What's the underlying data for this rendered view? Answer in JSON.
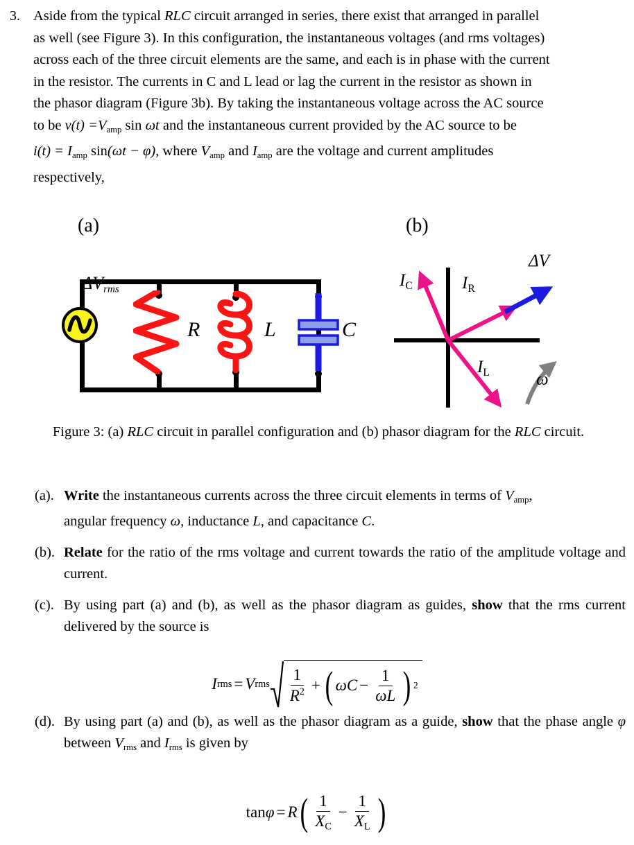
{
  "problem": {
    "number": "3.",
    "lines": [
      "Aside from the typical RLC circuit arranged in series, there exist that arranged in parallel",
      "as well (see Figure 3).  In this configuration, the instantaneous voltages (and rms voltages)",
      "across each of the three circuit elements are the same, and each is in phase with the current",
      "in the resistor.  The currents in C and L lead or lag the current in the resistor as shown in",
      "the phasor diagram (Figure 3b).  By taking the instantaneous voltage across the AC source",
      "to be v(t) = Vamp sin ωt and the instantaneous current provided by the AC source to be",
      "i(t) = Iamp sin(ωt − φ) , where Vamp and Iamp are the voltage and current amplitudes",
      "respectively,"
    ],
    "line1": {
      "w1": "Aside",
      "w2": "from",
      "w3": "the",
      "w4": "typical",
      "rlc": "RLC",
      "w5": "circuit",
      "w6": "arranged",
      "w7": "in",
      "w8": "series,",
      "w9": "there",
      "w10": "exist",
      "w11": "that",
      "w12": "arranged",
      "w13": "in",
      "w14": "parallel"
    },
    "line2": {
      "w1": "as",
      "w2": "well",
      "w3": "(see",
      "w4": "Figure",
      "w5": "3).",
      "w6": "In",
      "w7": "this",
      "w8": "configuration,",
      "w9": "the",
      "w10": "instantaneous",
      "w11": "voltages",
      "w12": "(and",
      "w13": "rms",
      "w14": "voltages)"
    },
    "line3": {
      "w1": "across",
      "w2": "each",
      "w3": "of",
      "w4": "the",
      "w5": "three",
      "w6": "circuit",
      "w7": "elements",
      "w8": "are",
      "w9": "the",
      "w10": "same,",
      "w11": "and",
      "w12": "each",
      "w13": "is",
      "w14": "in",
      "w15": "phase",
      "w16": "with",
      "w17": "the",
      "w18": "current"
    },
    "line4": {
      "w1": "in",
      "w2": "the",
      "w3": "resistor.",
      "w4": "The",
      "w5": "currents",
      "w6": "in",
      "w7": "C",
      "w8": "and",
      "w9": "L",
      "w10": "lead",
      "w11": "or",
      "w12": "lag",
      "w13": "the",
      "w14": "current",
      "w15": "in",
      "w16": "the",
      "w17": "resistor",
      "w18": "as",
      "w19": "shown",
      "w20": "in"
    },
    "line5": {
      "w1": "the",
      "w2": "phasor",
      "w3": "diagram",
      "w4": "(Figure",
      "w5": "3b).",
      "w6": "By",
      "w7": "taking",
      "w8": "the",
      "w9": "instantaneous",
      "w10": "voltage",
      "w11": "across",
      "w12": "the",
      "w13": "AC",
      "w14": "source"
    },
    "line6": {
      "w1": "to",
      "w2": "be",
      "eq_v": "v(t) =",
      "V": "V",
      "amp": "amp",
      "w3": "sin",
      "omega_t": "ωt",
      "w4": "and",
      "w5": "the",
      "w6": "instantaneous",
      "w7": "current",
      "w8": "provided",
      "w9": "by",
      "w10": "the",
      "w11": "AC",
      "w12": "source",
      "w13": "to",
      "w14": "be"
    },
    "line7": {
      "eq_i": "i(t) = I",
      "amp": "amp",
      "sin": "sin",
      "arg": "(ωt − φ)",
      "comma": ",",
      "w1": "where",
      "V": "V",
      "amp2": "amp",
      "w2": "and",
      "I": "I",
      "amp3": "amp",
      "w3": "are",
      "w4": "the",
      "w5": "voltage",
      "w6": "and",
      "w7": "current",
      "w8": "amplitudes"
    },
    "line8": "respectively,"
  },
  "figure": {
    "panel_a_label": "(a)",
    "panel_b_label": "(b)",
    "circuit": {
      "source_label_delta_v": "ΔV",
      "source_label_sub": "rms",
      "resistor_label": "R",
      "inductor_label": "L",
      "capacitor_label": "C",
      "colors": {
        "source_fill": "#f7f31e",
        "resistor": "#fa1414",
        "inductor": "#fa1414",
        "capacitor": "#1a1ae0",
        "capacitor_plate_inner": "#8f9ff0",
        "wire": "#000000"
      }
    },
    "phasor": {
      "ic_label": "I",
      "ic_sub": "C",
      "ir_label": "I",
      "ir_sub": "R",
      "il_label": "I",
      "il_sub": "L",
      "dv_label": "ΔV",
      "omega_label": "ω",
      "colors": {
        "current_arrow": "#ee1289",
        "voltage_arrow": "#1a1ae0",
        "omega_arrow": "#808080",
        "axis": "#000000"
      }
    },
    "caption": {
      "t1": "Figure 3: (a) ",
      "rlc1": "RLC",
      "t2": " circuit in parallel configuration and (b) phasor diagram for the ",
      "rlc2": "RLC",
      "t3": " circuit."
    }
  },
  "parts": {
    "a": {
      "marker": "(a).",
      "bold": "Write",
      "text1": " the instantaneous currents across the three circuit elements in terms of ",
      "V": "V",
      "Vsub": "amp",
      "text2": ",",
      "line2_a": "angular frequency ",
      "omega": "ω",
      "line2_b": ", inductance ",
      "L": "L",
      "line2_c": ", and capacitance ",
      "C": "C",
      "line2_d": "."
    },
    "b": {
      "marker": "(b).",
      "bold": "Relate",
      "text": " for the ratio of the rms voltage and current towards the ratio of the amplitude voltage and current."
    },
    "c": {
      "marker": "(c).",
      "text1": "By using part (a) and (b), as well as the phasor diagram as guides, ",
      "bold": "show",
      "text2": " that the rms current delivered by the source is"
    },
    "d": {
      "marker": "(d).",
      "text1": "By using part (a) and (b), as well as the phasor diagram as a guide, ",
      "bold": "show",
      "text2": " that the phase angle ",
      "phi": "φ",
      "text3": " between ",
      "V": "V",
      "Vsub": "rms",
      "text4": " and ",
      "I": "I",
      "Isub": "rms",
      "text5": " is given by"
    }
  },
  "equations": {
    "c": {
      "lhs_I": "I",
      "lhs_sub": "rms",
      "equals": "=",
      "rhs_V": "V",
      "rhs_sub": "rms",
      "frac1_num": "1",
      "frac1_den_R": "R",
      "frac1_den_exp": "2",
      "plus": "+",
      "omega_C": "ωC",
      "minus": "−",
      "frac2_num": "1",
      "frac2_den": "ωL",
      "power": "2",
      "paren_open": "(",
      "paren_close": ")"
    },
    "d": {
      "tan": "tan",
      "phi": "φ",
      "equals": "=",
      "R": "R",
      "paren_open": "(",
      "paren_close": ")",
      "frac1_num": "1",
      "frac1_den_X": "X",
      "frac1_den_sub": "C",
      "minus": "−",
      "frac2_num": "1",
      "frac2_den_X": "X",
      "frac2_den_sub": "L"
    }
  }
}
